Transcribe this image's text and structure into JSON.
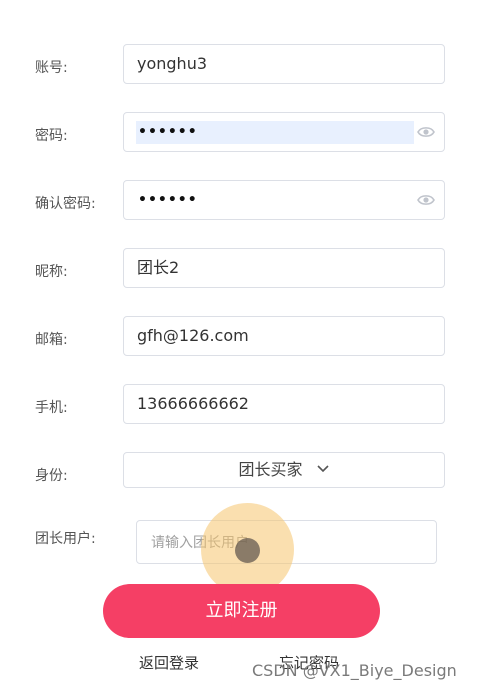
{
  "form": {
    "account": {
      "label": "账号:",
      "value": "yonghu3"
    },
    "password": {
      "label": "密码:",
      "value": "••••••"
    },
    "confirm_password": {
      "label": "确认密码:",
      "value": "••••••"
    },
    "nickname": {
      "label": "昵称:",
      "value": "团长2"
    },
    "email": {
      "label": "邮箱:",
      "value": "gfh@126.com"
    },
    "phone": {
      "label": "手机:",
      "value": "13666666662"
    },
    "identity": {
      "label": "身份:",
      "value": "团长买家"
    },
    "leader_user": {
      "label": "团长用户:",
      "placeholder": "请输入团长用户"
    }
  },
  "actions": {
    "register": "立即注册",
    "back_to_login": "返回登录",
    "forgot_password": "忘记密码"
  },
  "watermark": "CSDN @VX1_Biye_Design",
  "colors": {
    "accent": "#f53f65",
    "autofill": "#e8f0fe",
    "touch_ring": "#f6c46e"
  },
  "icons": {
    "password_toggle": "eye-icon",
    "identity_dropdown": "chevron-down-icon"
  }
}
